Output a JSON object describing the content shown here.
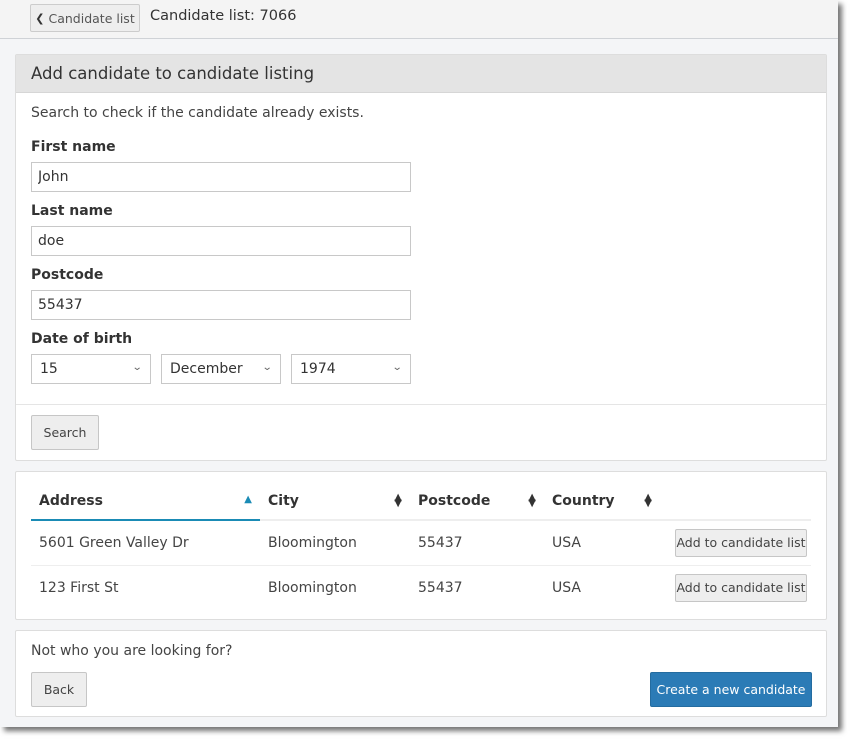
{
  "topbar": {
    "back_label": "Candidate list",
    "back_icon": "chevron-left-icon",
    "title": "Candidate list: 7066"
  },
  "search_panel": {
    "heading": "Add candidate to candidate listing",
    "intro": "Search to check if the candidate already exists.",
    "first_name": {
      "label": "First name",
      "value": "John"
    },
    "last_name": {
      "label": "Last name",
      "value": "doe"
    },
    "postcode": {
      "label": "Postcode",
      "value": "55437"
    },
    "dob": {
      "label": "Date of birth",
      "day": "15",
      "month": "December",
      "year": "1974"
    },
    "search_label": "Search"
  },
  "results": {
    "columns": [
      {
        "label": "Address",
        "sort": "ascending"
      },
      {
        "label": "City",
        "sort": "none"
      },
      {
        "label": "Postcode",
        "sort": "none"
      },
      {
        "label": "Country",
        "sort": "none"
      }
    ],
    "rows": [
      {
        "address": "5601 Green Valley Dr",
        "city": "Bloomington",
        "postcode": "55437",
        "country": "USA",
        "action": "Add to candidate list"
      },
      {
        "address": "123 First St",
        "city": "Bloomington",
        "postcode": "55437",
        "country": "USA",
        "action": "Add to candidate list"
      }
    ]
  },
  "footer_panel": {
    "prompt": "Not who you are looking for?",
    "back_label": "Back",
    "create_label": "Create a new candidate"
  },
  "colors": {
    "primary": "#2b7bb6",
    "sort_accent": "#1a8bb5",
    "panel_header_bg": "#e4e4e4",
    "page_bg": "#f4f5f7"
  }
}
